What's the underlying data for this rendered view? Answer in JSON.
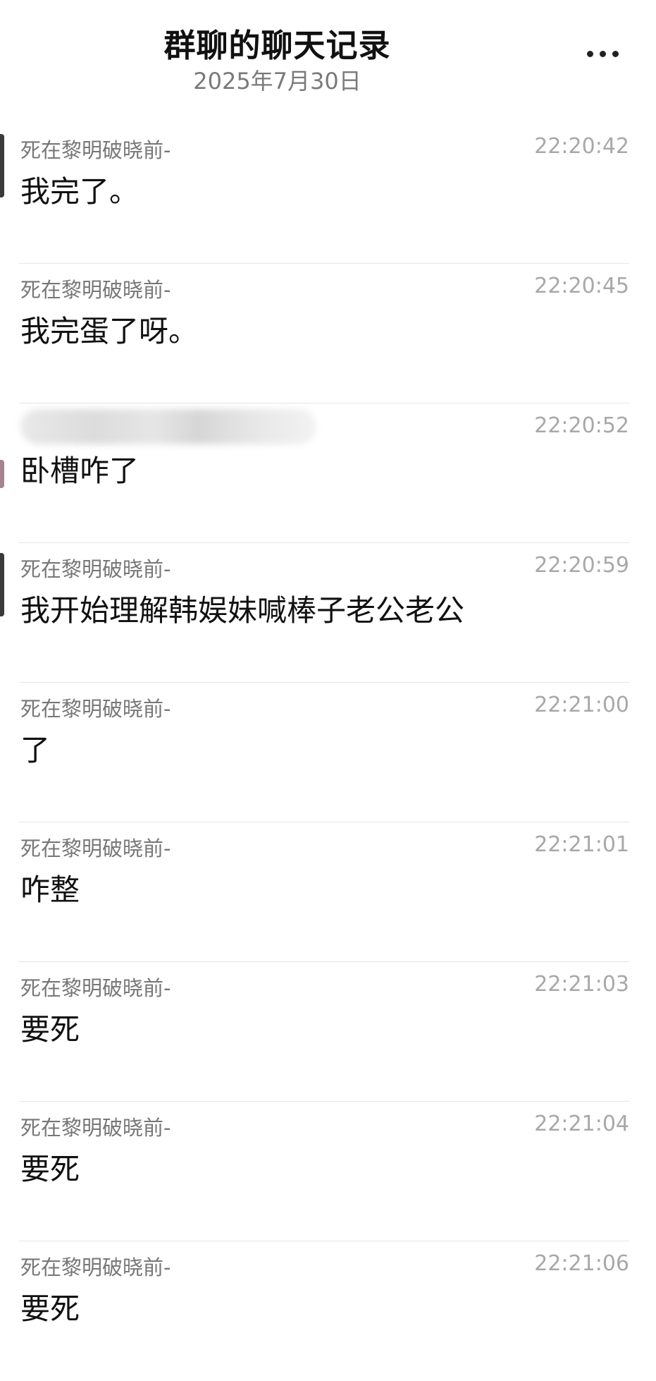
{
  "header": {
    "title": "群聊的聊天记录",
    "date": "2025年7月30日",
    "more_icon": "more-horizontal-icon"
  },
  "messages": [
    {
      "sender": "死在黎明破晓前-",
      "time": "22:20:42",
      "text": "我完了。"
    },
    {
      "sender": "死在黎明破晓前-",
      "time": "22:20:45",
      "text": "我完蛋了呀。"
    },
    {
      "sender": "",
      "time": "22:20:52",
      "text": "卧槽咋了"
    },
    {
      "sender": "死在黎明破晓前-",
      "time": "22:20:59",
      "text": "我开始理解韩娱妹喊棒子老公老公"
    },
    {
      "sender": "死在黎明破晓前-",
      "time": "22:21:00",
      "text": "了"
    },
    {
      "sender": "死在黎明破晓前-",
      "time": "22:21:01",
      "text": "咋整"
    },
    {
      "sender": "死在黎明破晓前-",
      "time": "22:21:03",
      "text": "要死"
    },
    {
      "sender": "死在黎明破晓前-",
      "time": "22:21:04",
      "text": "要死"
    },
    {
      "sender": "死在黎明破晓前-",
      "time": "22:21:06",
      "text": "要死"
    }
  ]
}
